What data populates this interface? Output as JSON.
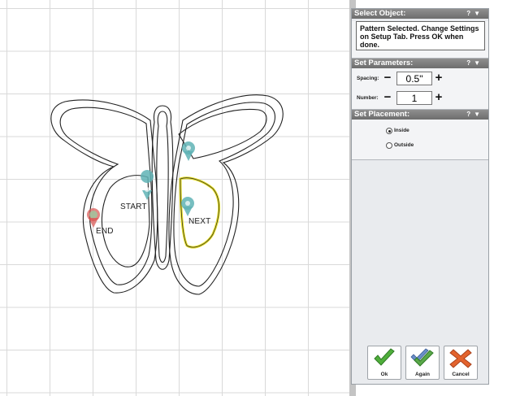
{
  "canvas": {
    "markers": {
      "start": "START",
      "end": "END",
      "next": "NEXT"
    }
  },
  "panel": {
    "select_object": {
      "title": "Select Object:",
      "message": "Pattern Selected. Change Settings on Setup Tab. Press OK when done."
    },
    "set_parameters": {
      "title": "Set Parameters:",
      "spacing_label": "Spacing:",
      "spacing_value": "0.5\"",
      "number_label": "Number:",
      "number_value": "1"
    },
    "set_placement": {
      "title": "Set Placement:",
      "options": [
        "Inside",
        "Outside"
      ],
      "selected": "Inside"
    },
    "header_icons": [
      "help-icon",
      "collapse-icon"
    ]
  },
  "actions": {
    "ok_label": "Ok",
    "again_label": "Again",
    "cancel_label": "Cancel"
  },
  "colors": {
    "selection_highlight": "#e8e020",
    "ok_green": "#4fae3b",
    "again_green": "#5aa84a",
    "cancel_orange": "#e3632d",
    "marker_teal": "#5fb3b5",
    "marker_red": "#d9534f",
    "panel_header": "#7a7a7a"
  }
}
